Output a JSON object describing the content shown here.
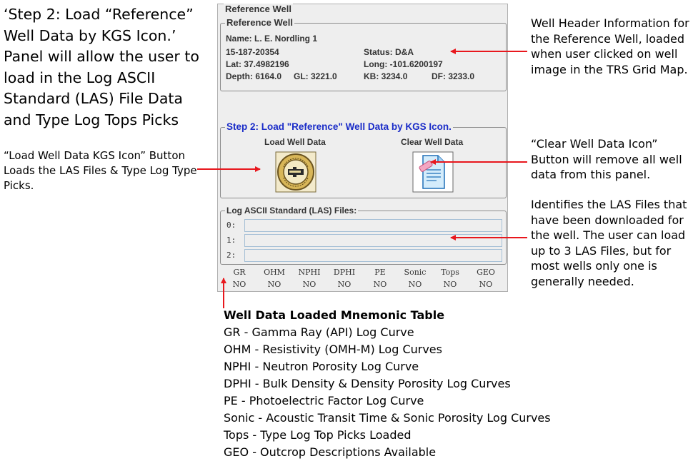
{
  "left_notes": {
    "step_caption": "‘Step 2: Load “Reference” Well Data by KGS Icon.’ Panel will allow the user to load in the Log ASCII Standard (LAS) File Data and Type Log Tops Picks",
    "load_caption": "“Load Well Data KGS Icon” Button Loads the LAS Files & Type Log Type Picks."
  },
  "right_notes": {
    "header_note": "Well Header Information for the Reference Well, loaded when user clicked on well image in the TRS Grid Map.",
    "clear_note": "“Clear Well Data Icon” Button will remove all well data from this panel.",
    "las_note": "Identifies the LAS Files that have been downloaded for the well.  The user can load up to 3 LAS Files, but for most wells only one is generally needed."
  },
  "panel": {
    "outer_title": "Reference Well",
    "reference": {
      "title": "Reference Well",
      "name": "Name: L. E. Nordling 1",
      "api": "15-187-20354",
      "status": "Status: D&A",
      "lat": "Lat: 37.4982196",
      "long": "Long: -101.6200197",
      "depth": "Depth: 6164.0",
      "gl": "GL: 3221.0",
      "kb": "KB: 3234.0",
      "df": "DF: 3233.0"
    },
    "step2": {
      "title": "Step 2: Load \"Reference\" Well Data by KGS Icon.",
      "load_label": "Load Well Data",
      "clear_label": "Clear Well Data",
      "load_icon": "kgs-seal-icon",
      "clear_icon": "clear-document-icon"
    },
    "las": {
      "title": "Log ASCII Standard (LAS) Files:",
      "rows": [
        {
          "label": "0:",
          "value": ""
        },
        {
          "label": "1:",
          "value": ""
        },
        {
          "label": "2:",
          "value": ""
        }
      ]
    },
    "mnemonics": [
      {
        "name": "GR",
        "value": "NO"
      },
      {
        "name": "OHM",
        "value": "NO"
      },
      {
        "name": "NPHI",
        "value": "NO"
      },
      {
        "name": "DPHI",
        "value": "NO"
      },
      {
        "name": "PE",
        "value": "NO"
      },
      {
        "name": "Sonic",
        "value": "NO"
      },
      {
        "name": "Tops",
        "value": "NO"
      },
      {
        "name": "GEO",
        "value": "NO"
      }
    ]
  },
  "legend": {
    "title": "Well Data Loaded Mnemonic Table",
    "lines": [
      "GR      - Gamma Ray (API) Log Curve",
      "OHM - Resistivity (OMH-M) Log Curves",
      "NPHI  - Neutron Porosity Log Curve",
      "DPHI - Bulk Density & Density Porosity Log Curves",
      "PE      - Photoelectric Factor Log Curve",
      "Sonic - Acoustic Transit Time & Sonic Porosity Log Curves",
      "Tops  - Type Log Top Picks Loaded",
      "GEO  - Outcrop Descriptions Available"
    ]
  },
  "colors": {
    "arrow": "#e8171d",
    "step_title": "#1a2cc8"
  }
}
